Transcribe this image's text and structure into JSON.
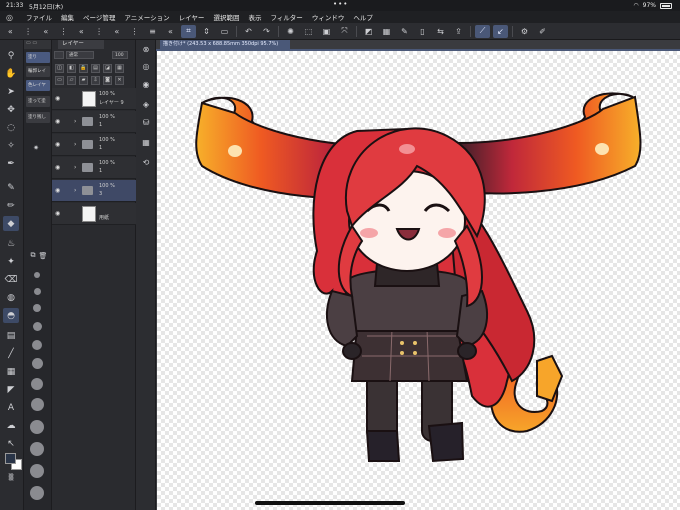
{
  "status": {
    "time": "21:33",
    "date": "5月12日(木)",
    "battery": "97%"
  },
  "menu": [
    "ファイル",
    "編集",
    "ページ管理",
    "アニメーション",
    "レイヤー",
    "選択範囲",
    "表示",
    "フィルター",
    "ウィンドウ",
    "ヘルプ"
  ],
  "document_tab": "描き付け* (243.53 x 688.85mm 350dpi 95.7%)",
  "subtool_items": [
    "塗り",
    "輪郭レイ",
    "色レイヤ",
    "塗って塗",
    "塗り残し"
  ],
  "layer_panel": {
    "tab": "レイヤー",
    "blend": "通常",
    "opacity": "100",
    "layers": [
      {
        "pct": "100 %",
        "name": "レイヤー 9",
        "type": "raster"
      },
      {
        "pct": "100 %",
        "name": "1",
        "type": "folder"
      },
      {
        "pct": "100 %",
        "name": "1",
        "type": "folder"
      },
      {
        "pct": "100 %",
        "name": "1",
        "type": "folder"
      },
      {
        "pct": "100 %",
        "name": "3",
        "type": "folder",
        "selected": true
      },
      {
        "pct": "",
        "name": "用紙",
        "type": "paper"
      }
    ]
  },
  "colors": {
    "accent": "#4a5878",
    "main_color": "#2a3548",
    "sub_color": "#ffffff"
  }
}
